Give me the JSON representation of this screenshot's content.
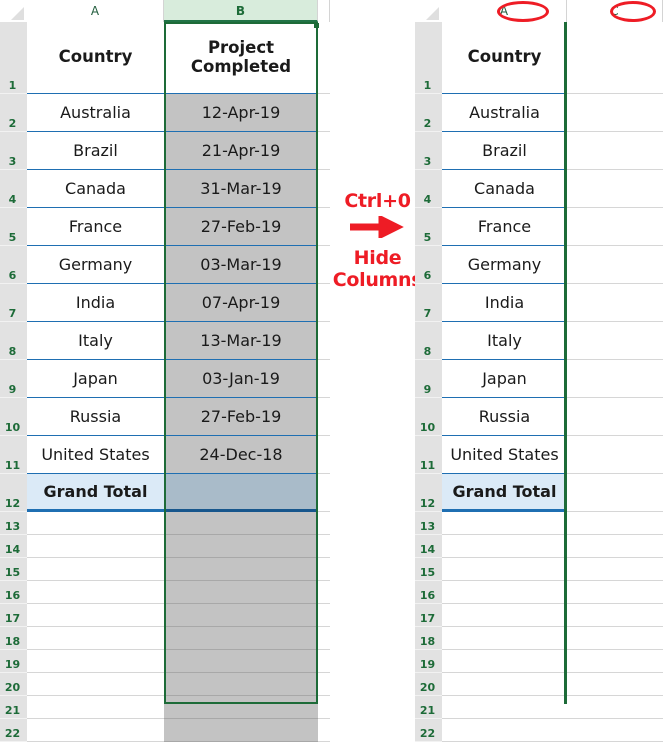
{
  "app": "excel-worksheet-hide-columns-illustration",
  "left_sheet": {
    "name": "before-hiding",
    "column_headers": [
      {
        "label": "A",
        "selected": false
      },
      {
        "label": "B",
        "selected": true
      }
    ],
    "row_headers": [
      "1",
      "2",
      "3",
      "4",
      "5",
      "6",
      "7",
      "8",
      "9",
      "10",
      "11",
      "12",
      "13",
      "14",
      "15",
      "16",
      "17",
      "18",
      "19",
      "20",
      "21",
      "22"
    ],
    "table": {
      "headers": [
        "Country",
        "Project\nCompleted"
      ],
      "header_lines_b": [
        "Project",
        "Completed"
      ],
      "rows": [
        {
          "country": "Australia",
          "project_completed": "12-Apr-19"
        },
        {
          "country": "Brazil",
          "project_completed": "21-Apr-19"
        },
        {
          "country": "Canada",
          "project_completed": "31-Mar-19"
        },
        {
          "country": "France",
          "project_completed": "27-Feb-19"
        },
        {
          "country": "Germany",
          "project_completed": "03-Mar-19"
        },
        {
          "country": "India",
          "project_completed": "07-Apr-19"
        },
        {
          "country": "Italy",
          "project_completed": "13-Mar-19"
        },
        {
          "country": "Japan",
          "project_completed": "03-Jan-19"
        },
        {
          "country": "Russia",
          "project_completed": "27-Feb-19"
        },
        {
          "country": "United States",
          "project_completed": "24-Dec-18"
        }
      ],
      "total_row": {
        "country": "Grand Total",
        "project_completed": ""
      }
    }
  },
  "annotation": {
    "shortcut_label": "Ctrl+0",
    "arrow_icon": "right-arrow-icon",
    "action_line1": "Hide",
    "action_line2": "Columns",
    "color": "#ee1c25"
  },
  "right_sheet": {
    "name": "after-hiding",
    "column_headers": [
      {
        "label": "A",
        "selected": false,
        "circled": true
      },
      {
        "label": "C",
        "selected": false,
        "circled": true
      }
    ],
    "hidden_column": "B",
    "row_headers": [
      "1",
      "2",
      "3",
      "4",
      "5",
      "6",
      "7",
      "8",
      "9",
      "10",
      "11",
      "12",
      "13",
      "14",
      "15",
      "16",
      "17",
      "18",
      "19",
      "20",
      "21",
      "22"
    ],
    "table": {
      "headers": [
        "Country"
      ],
      "rows": [
        {
          "country": "Australia"
        },
        {
          "country": "Brazil"
        },
        {
          "country": "Canada"
        },
        {
          "country": "France"
        },
        {
          "country": "Germany"
        },
        {
          "country": "India"
        },
        {
          "country": "Italy"
        },
        {
          "country": "Japan"
        },
        {
          "country": "Russia"
        },
        {
          "country": "United States"
        }
      ],
      "total_row": {
        "country": "Grand Total"
      }
    }
  },
  "colors": {
    "selection_green": "#1d6b38",
    "header_selected_fill": "#d8ecdc",
    "table_border_blue": "#1f6fb2",
    "total_fill": "#dbeaf7",
    "selected_cell_fill": "#c3c3c3",
    "annotation_red": "#ee1c25",
    "row_header_fill": "#e2e2e2"
  }
}
